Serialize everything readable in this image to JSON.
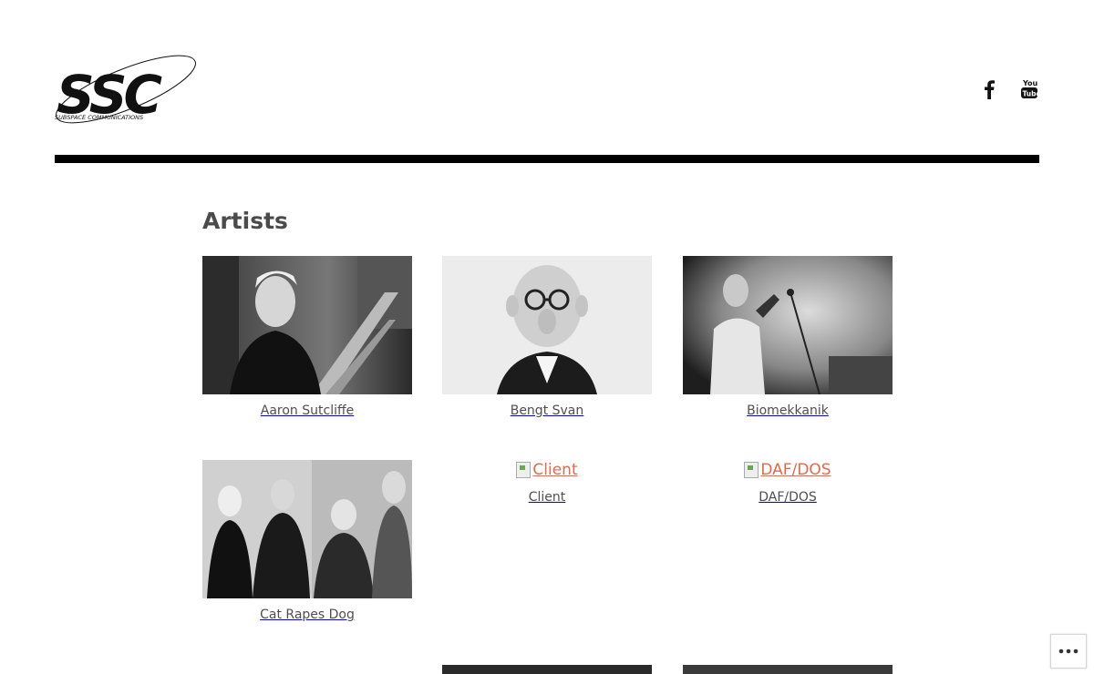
{
  "header": {
    "logo_text": "SSC",
    "logo_subtext": "SUBSPACE COMMUNICATIONS",
    "social": [
      {
        "icon": "facebook-icon",
        "label": "Facebook"
      },
      {
        "icon": "youtube-icon",
        "label": "YouTube"
      }
    ]
  },
  "page": {
    "title": "Artists"
  },
  "artists": [
    {
      "name": "Aaron Sutcliffe",
      "image": "photo"
    },
    {
      "name": "Bengt Svan",
      "image": "photo"
    },
    {
      "name": "Biomekkanik",
      "image": "photo"
    },
    {
      "name": "Cat Rapes Dog",
      "image": "photo"
    },
    {
      "name": "Client",
      "image": "broken",
      "alt": "Client"
    },
    {
      "name": "DAF/DOS",
      "image": "broken",
      "alt": "DAF/DOS"
    }
  ],
  "overflow_menu": {
    "icon": "ellipsis-icon"
  },
  "colors": {
    "rule": "#000000",
    "link": "#e26a4a",
    "text": "#4b4b4b"
  }
}
